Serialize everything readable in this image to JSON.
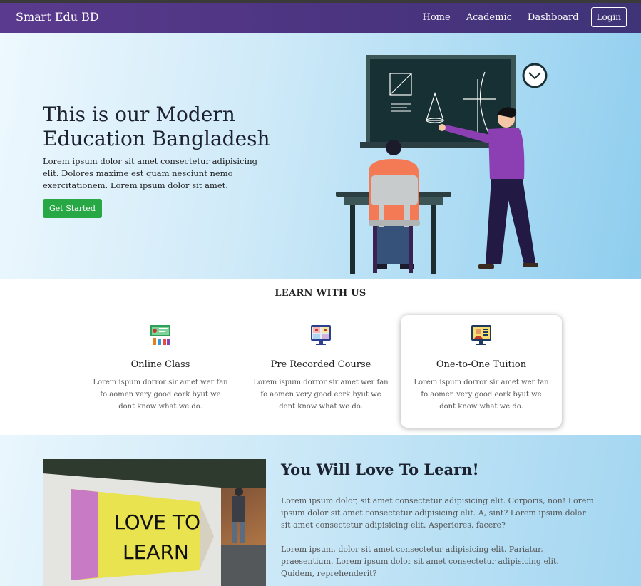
{
  "navbar": {
    "brand": "Smart Edu BD",
    "links": [
      "Home",
      "Academic",
      "Dashboard"
    ],
    "login_label": "Login"
  },
  "hero": {
    "title": "This is our Modern Education Bangladesh",
    "text": "Lorem ipsum dolor sit amet consectetur adipisicing elit. Dolores maxime est quam nesciunt nemo exercitationem. Lorem ipsum dolor sit amet.",
    "button_label": "Get Started"
  },
  "learn": {
    "heading": "LEARN WITH US",
    "cards": [
      {
        "title": "Online Class",
        "text": "Lorem ispum dorror sir amet wer fan fo aomen very good eork byut we dont know what we do.",
        "icon": "classroom-icon"
      },
      {
        "title": "Pre Recorded Course",
        "text": "Lorem ispum dorror sir amet wer fan fo aomen very good eork byut we dont know what we do.",
        "icon": "video-course-icon"
      },
      {
        "title": "One-to-One Tuition",
        "text": "Lorem ispum dorror sir amet wer fan fo aomen very good eork byut we dont know what we do.",
        "icon": "tutor-screen-icon"
      }
    ]
  },
  "love": {
    "title": "You Will Love To Learn!",
    "p1": "Lorem ipsum dolor, sit amet consectetur adipisicing elit. Corporis, non! Lorem ipsum dolor sit amet consectetur adipisicing elit. A, sint? Lorem ipsum dolor sit amet consectetur adipisicing elit. Asperiores, facere?",
    "p2": "Lorem ipsum, dolor sit amet consectetur adipisicing elit. Pariatur, praesentium. Lorem ipsum dolor sit amet consectetur adipisicing elit. Quidem, reprehenderit?",
    "photo_sign_line1": "LOVE TO",
    "photo_sign_line2": "LEARN"
  },
  "colors": {
    "navbar": "#4b3480",
    "accent_green": "#28a745",
    "hero_blue": "#a9daf3"
  }
}
